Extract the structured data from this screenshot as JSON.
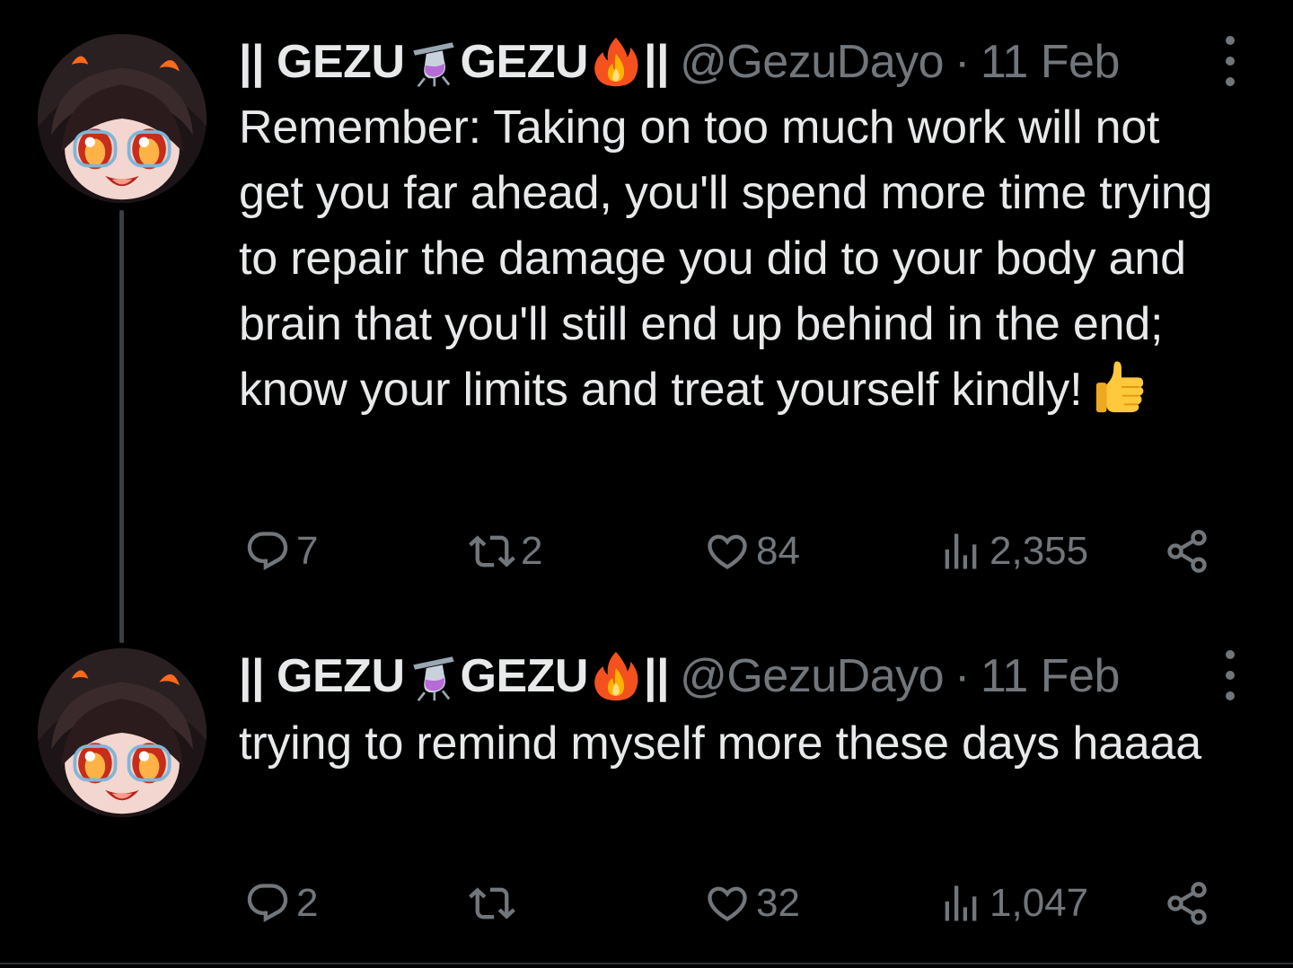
{
  "thread": {
    "tweets": [
      {
        "author": {
          "name_part1": "|| GEZU",
          "name_part2": "GEZU",
          "name_part3": "||",
          "handle": "@GezuDayo"
        },
        "separator": "·",
        "date": "11 Feb",
        "text": "Remember: Taking on too much work will not get you far ahead, you'll spend more time trying to repair the damage you did to your body and brain that you'll still end up behind in the end; know your limits and treat yourself kindly!",
        "stats": {
          "replies": "7",
          "retweets": "2",
          "likes": "84",
          "views": "2,355"
        }
      },
      {
        "author": {
          "name_part1": "|| GEZU",
          "name_part2": "GEZU",
          "name_part3": "||",
          "handle": "@GezuDayo"
        },
        "separator": "·",
        "date": "11 Feb",
        "text": "trying to remind myself more these days haaaa",
        "stats": {
          "replies": "2",
          "retweets": "",
          "likes": "32",
          "views": "1,047"
        }
      }
    ]
  },
  "icons": {
    "name_emoji_1": "test-tube-emoji",
    "name_emoji_2": "fire-emoji",
    "text_emoji": "thumbs-up-emoji",
    "actions": [
      "reply-icon",
      "retweet-icon",
      "like-icon",
      "views-icon",
      "share-icon"
    ]
  },
  "colors": {
    "background": "#000000",
    "text_primary": "#e7e9ea",
    "text_secondary": "#71767b",
    "thread_line": "#3a3f44"
  }
}
